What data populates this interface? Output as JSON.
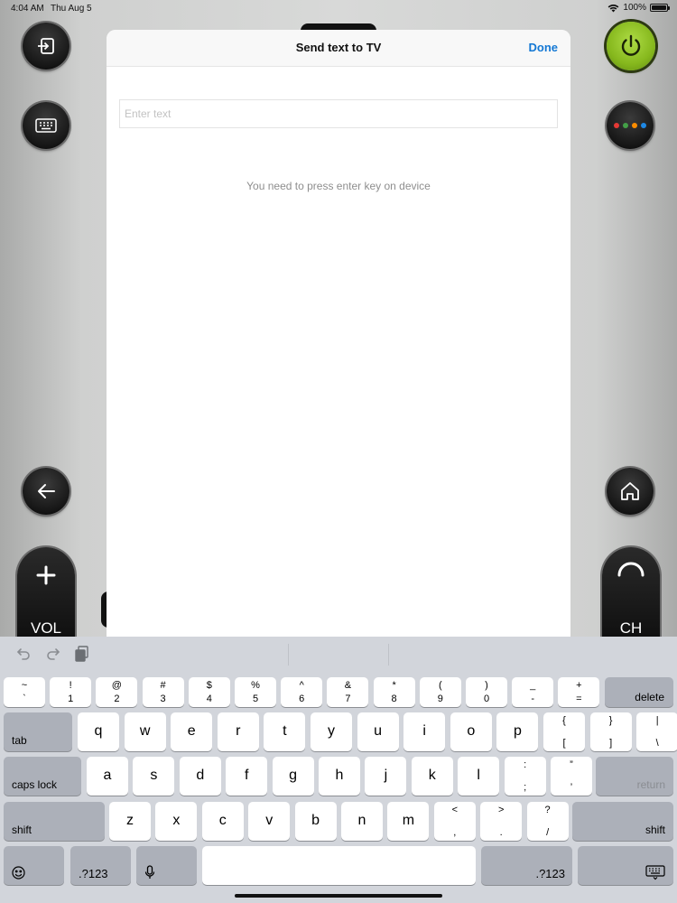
{
  "status": {
    "time": "4:04 AM",
    "date": "Thu Aug 5",
    "battery": "100%",
    "battery_level": 1.0
  },
  "remote": {
    "vol_label": "VOL",
    "ch_label": "CH",
    "color_dots": [
      "#e53935",
      "#43a047",
      "#fb8c00",
      "#1e88e5"
    ]
  },
  "modal": {
    "title": "Send text to TV",
    "done_label": "Done",
    "input_placeholder": "Enter text",
    "input_value": "",
    "hint": "You need to press enter key on device"
  },
  "keyboard": {
    "number_row": [
      {
        "top": "~",
        "bottom": "`"
      },
      {
        "top": "!",
        "bottom": "1"
      },
      {
        "top": "@",
        "bottom": "2"
      },
      {
        "top": "#",
        "bottom": "3"
      },
      {
        "top": "$",
        "bottom": "4"
      },
      {
        "top": "%",
        "bottom": "5"
      },
      {
        "top": "^",
        "bottom": "6"
      },
      {
        "top": "&",
        "bottom": "7"
      },
      {
        "top": "*",
        "bottom": "8"
      },
      {
        "top": "(",
        "bottom": "9"
      },
      {
        "top": ")",
        "bottom": "0"
      },
      {
        "top": "_",
        "bottom": "-"
      },
      {
        "top": "+",
        "bottom": "="
      }
    ],
    "delete_label": "delete",
    "tab_label": "tab",
    "row_q": [
      "q",
      "w",
      "e",
      "r",
      "t",
      "y",
      "u",
      "i",
      "o",
      "p"
    ],
    "row_q_extra": [
      {
        "top": "{",
        "bottom": "["
      },
      {
        "top": "}",
        "bottom": "]"
      },
      {
        "top": "|",
        "bottom": "\\"
      }
    ],
    "caps_label": "caps lock",
    "row_a": [
      "a",
      "s",
      "d",
      "f",
      "g",
      "h",
      "j",
      "k",
      "l"
    ],
    "row_a_extra": [
      {
        "top": ":",
        "bottom": ";"
      },
      {
        "top": "”",
        "bottom": "’"
      }
    ],
    "return_label": "return",
    "shift_label": "shift",
    "row_z": [
      "z",
      "x",
      "c",
      "v",
      "b",
      "n",
      "m"
    ],
    "row_z_extra": [
      {
        "top": "<",
        "bottom": ","
      },
      {
        "top": ">",
        "bottom": "."
      },
      {
        "top": "?",
        "bottom": "/"
      }
    ],
    "num_label": ".?123"
  }
}
